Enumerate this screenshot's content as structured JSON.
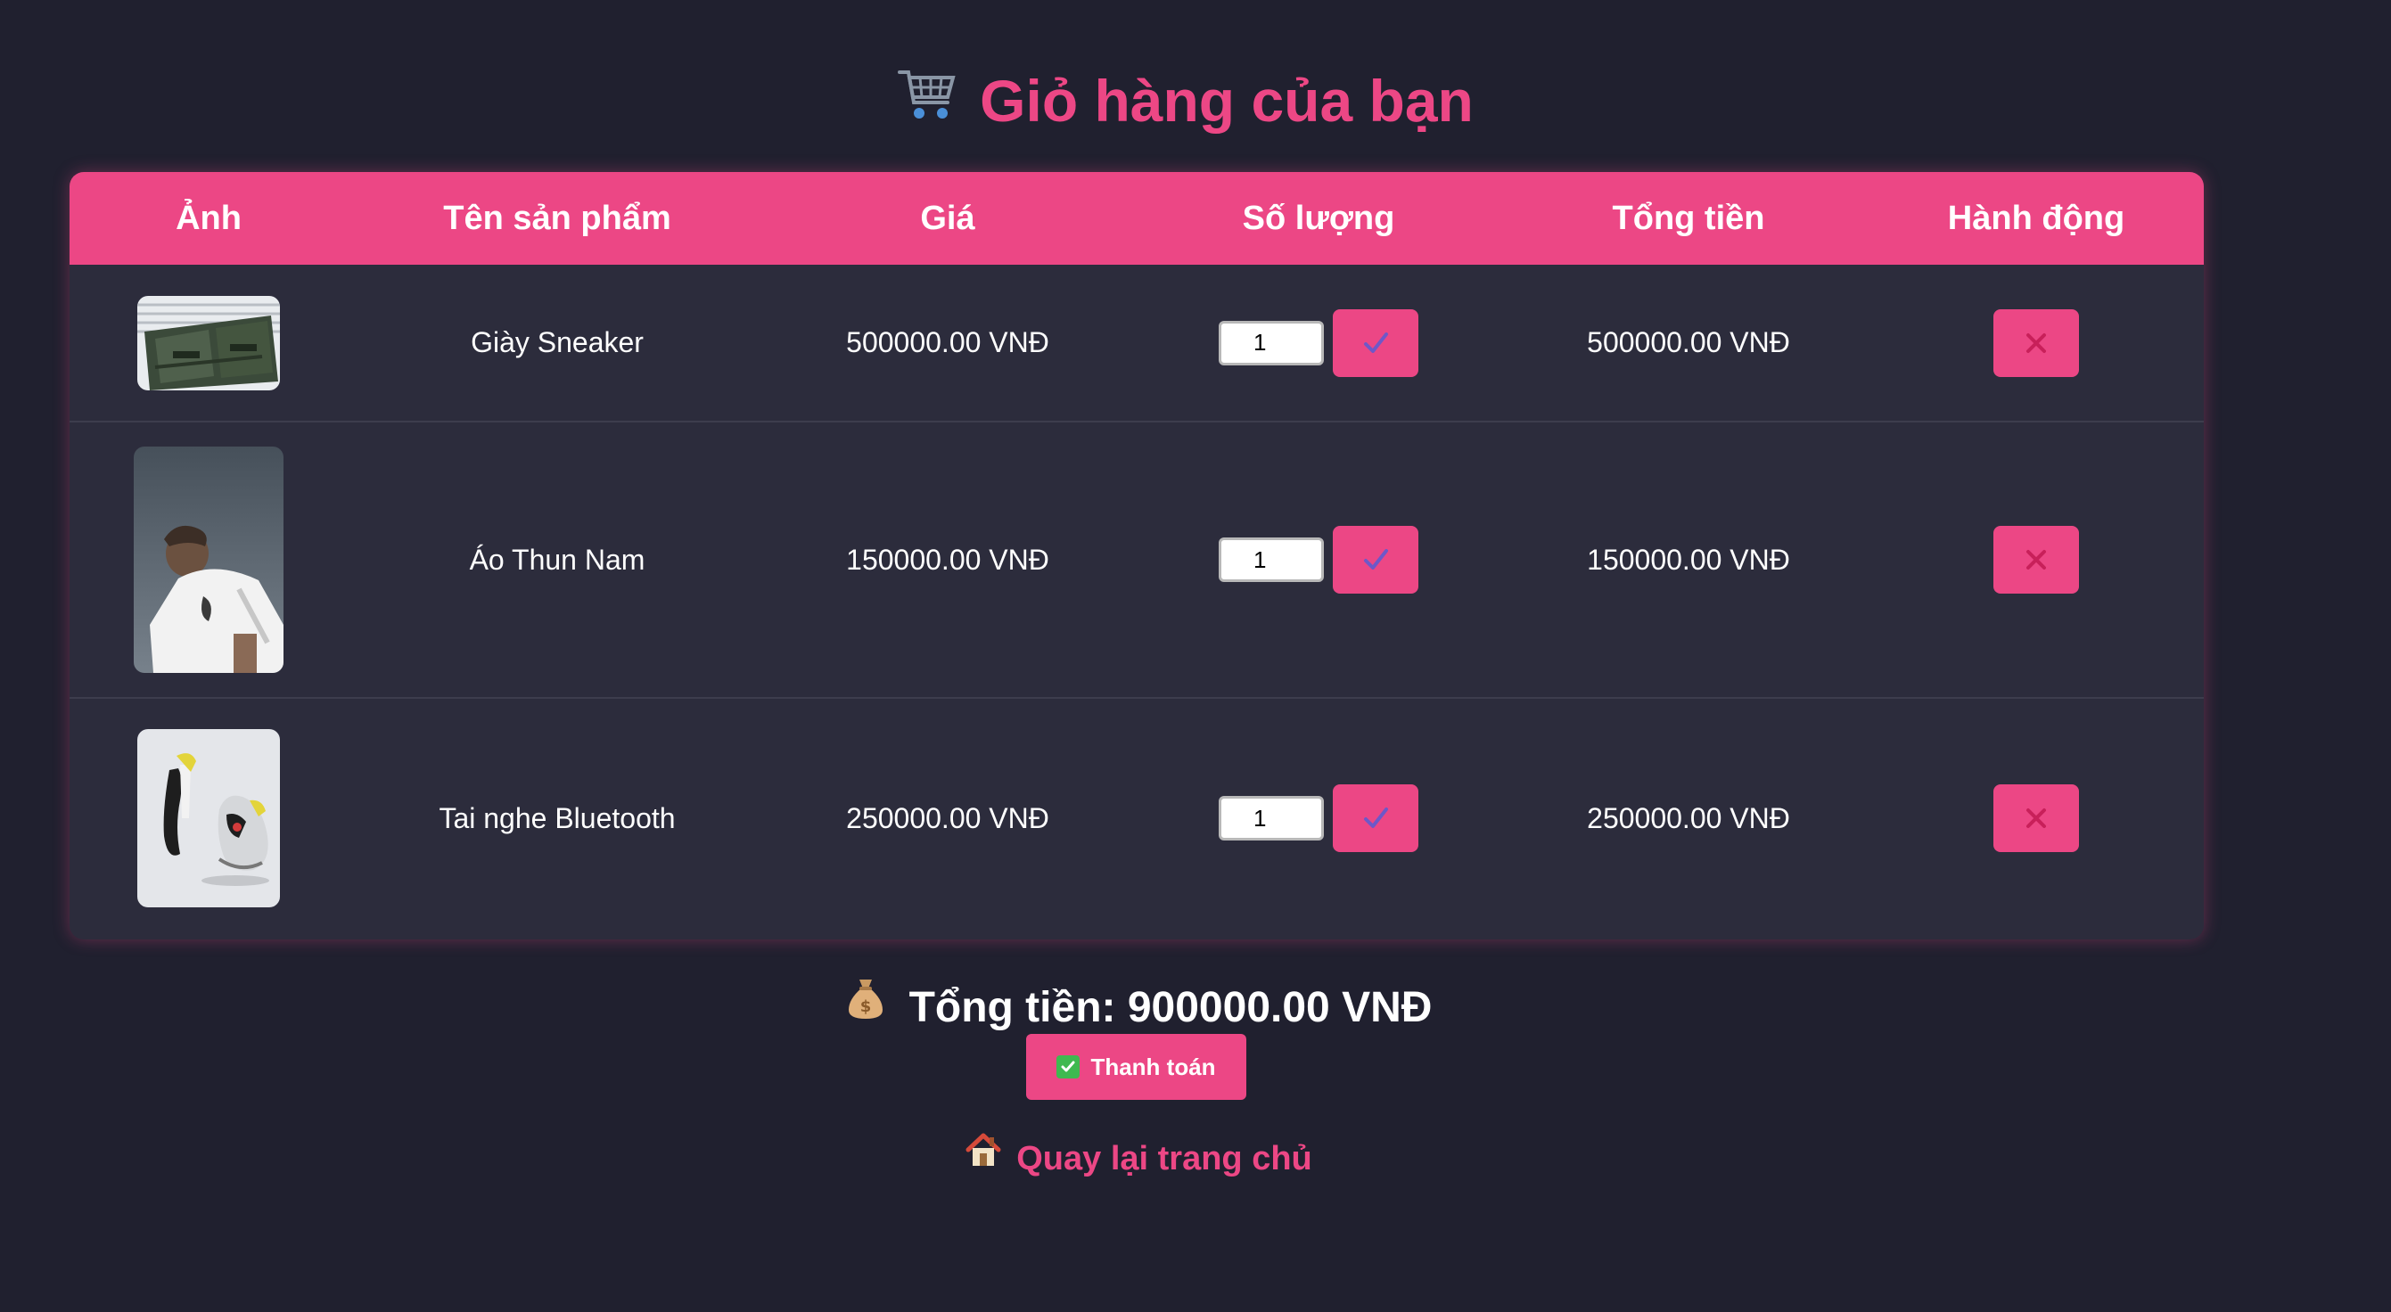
{
  "page": {
    "title": "Giỏ hàng của bạn",
    "title_icon": "shopping-cart-icon"
  },
  "table": {
    "headers": {
      "image": "Ảnh",
      "name": "Tên sản phẩm",
      "price": "Giá",
      "quantity": "Số lượng",
      "total": "Tổng tiền",
      "action": "Hành động"
    },
    "rows": [
      {
        "image_icon": "product-photo-bag",
        "name": "Giày Sneaker",
        "price": "500000.00 VNĐ",
        "quantity": "1",
        "total": "500000.00 VNĐ"
      },
      {
        "image_icon": "product-photo-man-tshirt",
        "name": "Áo Thun Nam",
        "price": "150000.00 VNĐ",
        "quantity": "1",
        "total": "150000.00 VNĐ"
      },
      {
        "image_icon": "product-photo-sneakers",
        "name": "Tai nghe Bluetooth",
        "price": "250000.00 VNĐ",
        "quantity": "1",
        "total": "250000.00 VNĐ"
      }
    ],
    "update_icon": "checkmark-icon",
    "remove_icon": "close-icon"
  },
  "summary": {
    "icon": "money-bag-icon",
    "text": "Tổng tiền: 900000.00 VNĐ"
  },
  "checkout": {
    "icon": "check-box-icon",
    "label": "Thanh toán"
  },
  "back": {
    "icon": "house-icon",
    "label": "Quay lại trang chủ"
  },
  "colors": {
    "background": "#20202f",
    "panel": "#2c2c3c",
    "accent": "#ec4785",
    "text": "#ffffff"
  }
}
